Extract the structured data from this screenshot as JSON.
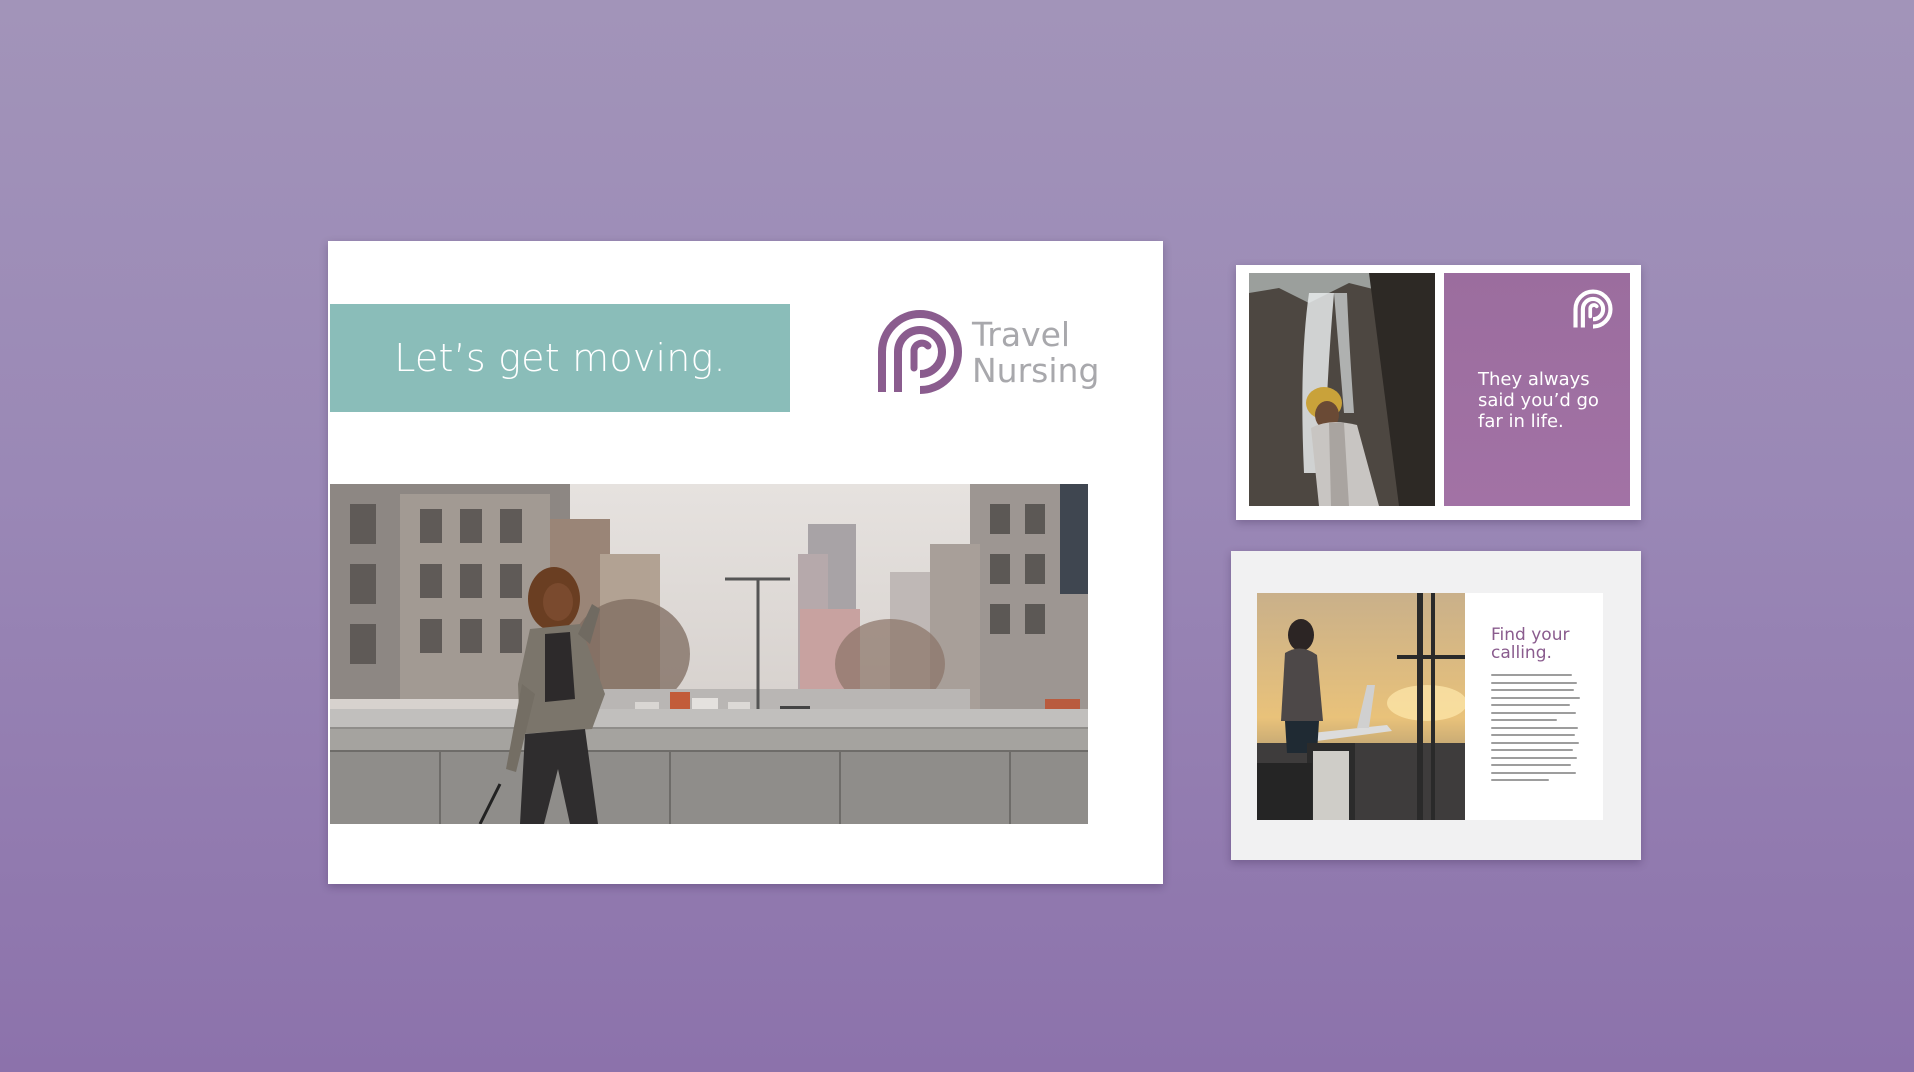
{
  "main_card": {
    "headline": "Let’s get moving.",
    "brand": {
      "line1": "Travel",
      "line2": "Nursing",
      "logo_icon": "travel-nursing-logo-icon"
    }
  },
  "waterfall_card": {
    "tagline": [
      "They always",
      "said you’d go",
      "far in life."
    ],
    "logo_icon": "travel-nursing-logo-icon"
  },
  "airport_card": {
    "heading": [
      "Find your",
      "calling."
    ],
    "body_line_count": 15
  },
  "colors": {
    "background_top": "#a294b9",
    "background_bottom": "#8c72ab",
    "teal_accent": "#8abdb9",
    "purple_accent": "#9b6d9e",
    "logo_purple": "#8a5c8e",
    "brand_gray": "#a8a8ac"
  }
}
